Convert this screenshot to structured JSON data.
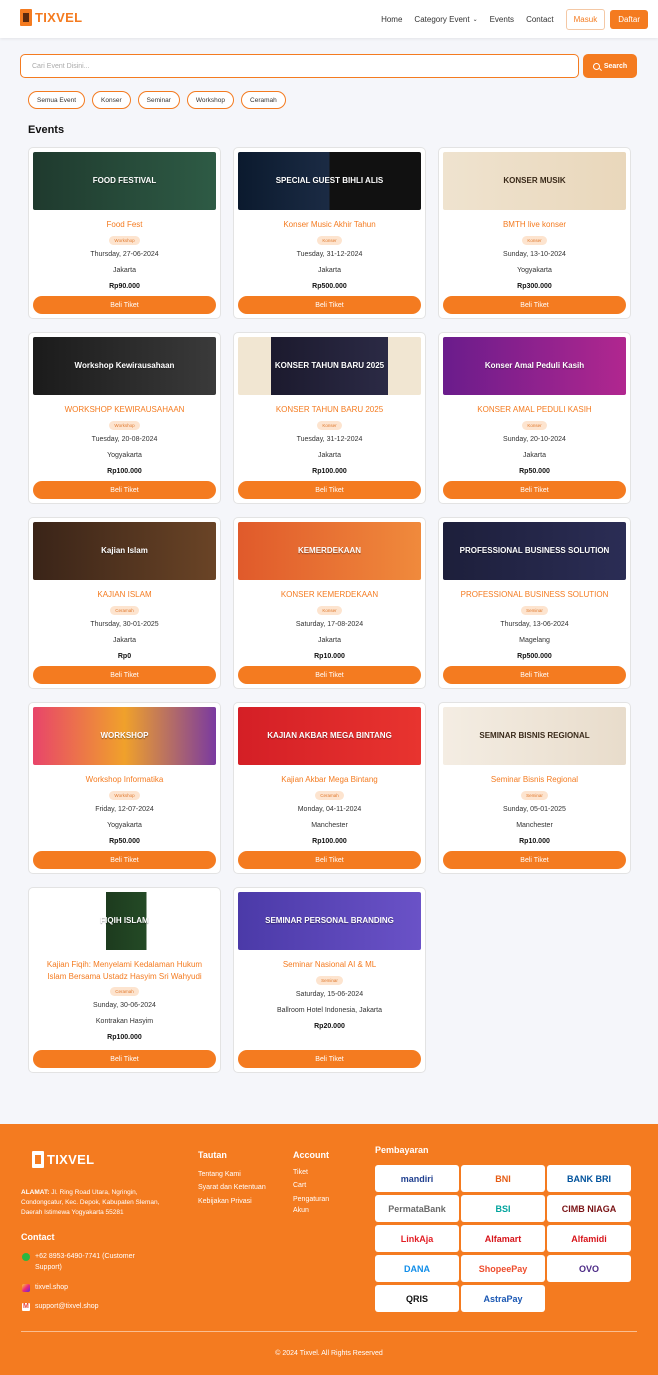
{
  "brand": {
    "name": "TIXVEL"
  },
  "nav": {
    "items": [
      "Home",
      "Category Event",
      "Events",
      "Contact"
    ],
    "login": "Masuk",
    "register": "Daftar"
  },
  "search": {
    "placeholder": "Cari Event Disini...",
    "button": "Search"
  },
  "filters": [
    "Semua Event",
    "Konser",
    "Seminar",
    "Workshop",
    "Ceramah"
  ],
  "section_title": "Events",
  "buy_label": "Beli Tiket",
  "events": [
    {
      "title": "Food Fest",
      "category": "Workshop",
      "date": "Thursday, 27-06-2024",
      "location": "Jakarta",
      "price": "Rp90.000",
      "banner": "FOOD FESTIVAL",
      "bg": "linear-gradient(90deg,#1f3a2e,#2e5b45)"
    },
    {
      "title": "Konser Music Akhir Tahun",
      "category": "Konser",
      "date": "Tuesday, 31-12-2024",
      "location": "Jakarta",
      "price": "Rp500.000",
      "banner": "SPECIAL GUEST BIHLI ALIS",
      "bg": "linear-gradient(90deg,#0b1a2e,#1b2b44 50%,#111 50%)"
    },
    {
      "title": "BMTH live konser",
      "category": "Konser",
      "date": "Sunday, 13-10-2024",
      "location": "Yogyakarta",
      "price": "Rp300.000",
      "banner": "KONSER MUSIK",
      "bg": "linear-gradient(90deg,#efe3cf,#e9d7bb)",
      "dark": true
    },
    {
      "title": "WORKSHOP KEWIRAUSAHAAN",
      "category": "Workshop",
      "date": "Tuesday, 20-08-2024",
      "location": "Yogyakarta",
      "price": "Rp100.000",
      "banner": "Workshop Kewirausahaan",
      "bg": "linear-gradient(90deg,#1b1b1b,#3a3a3a)"
    },
    {
      "title": "KONSER TAHUN BARU 2025",
      "category": "Konser",
      "date": "Tuesday, 31-12-2024",
      "location": "Jakarta",
      "price": "Rp100.000",
      "banner": "KONSER TAHUN BARU 2025",
      "bg": "linear-gradient(90deg,#f1e6d2 18%,#1c1a2e 18%,#2b2a45 82%,#f1e6d2 82%)"
    },
    {
      "title": "KONSER AMAL PEDULI KASIH",
      "category": "Konser",
      "date": "Sunday, 20-10-2024",
      "location": "Jakarta",
      "price": "Rp50.000",
      "banner": "Konser Amal Peduli Kasih",
      "bg": "linear-gradient(90deg,#6a1c8c,#b1278f)"
    },
    {
      "title": "KAJIAN ISLAM",
      "category": "Ceramah",
      "date": "Thursday, 30-01-2025",
      "location": "Jakarta",
      "price": "Rp0",
      "banner": "Kajian Islam",
      "bg": "linear-gradient(90deg,#3a2418,#6a4426)"
    },
    {
      "title": "KONSER KEMERDEKAAN",
      "category": "Konser",
      "date": "Saturday, 17-08-2024",
      "location": "Jakarta",
      "price": "Rp10.000",
      "banner": "KEMERDEKAAN",
      "bg": "linear-gradient(90deg,#e05a2b,#f08a3c)"
    },
    {
      "title": "PROFESSIONAL BUSINESS SOLUTION",
      "category": "Seminar",
      "date": "Thursday, 13-06-2024",
      "location": "Magelang",
      "price": "Rp500.000",
      "banner": "PROFESSIONAL BUSINESS SOLUTION",
      "bg": "linear-gradient(90deg,#1d1f3b,#2b2d55)"
    },
    {
      "title": "Workshop Informatika",
      "category": "Workshop",
      "date": "Friday, 12-07-2024",
      "location": "Yogyakarta",
      "price": "Rp50.000",
      "banner": "WORKSHOP",
      "bg": "linear-gradient(90deg,#e8456a,#f0a12b 50%,#7a3aa0)"
    },
    {
      "title": "Kajian Akbar Mega Bintang",
      "category": "Ceramah",
      "date": "Monday, 04-11-2024",
      "location": "Manchester",
      "price": "Rp100.000",
      "banner": "KAJIAN AKBAR MEGA BINTANG",
      "bg": "linear-gradient(90deg,#d41f26,#e8342f)"
    },
    {
      "title": "Seminar Bisnis Regional",
      "category": "Seminar",
      "date": "Sunday, 05-01-2025",
      "location": "Manchester",
      "price": "Rp10.000",
      "banner": "SEMINAR BISNIS REGIONAL",
      "bg": "linear-gradient(90deg,#f4ede3,#e8dccb)",
      "dark": true
    },
    {
      "title": "Kajian Fiqih: Menyelami Kedalaman Hukum Islam Bersama Ustadz Hasyim Sri Wahyudi",
      "category": "Ceramah",
      "date": "Sunday, 30-06-2024",
      "location": "Kontrakan Hasyim",
      "price": "Rp100.000",
      "banner": "FIQIH ISLAM",
      "bg": "linear-gradient(90deg,#fff 40%,#1d3b1e 40%,#244a26 62%,#fff 62%)",
      "tall": true
    },
    {
      "title": "Seminar Nasional AI & ML",
      "category": "Seminar",
      "date": "Saturday, 15-06-2024",
      "location": "Ballroom Hotel Indonesia, Jakarta",
      "price": "Rp20.000",
      "banner": "SEMINAR PERSONAL BRANDING",
      "bg": "linear-gradient(90deg,#4b3aa8,#6a52c7)",
      "tall": true
    }
  ],
  "footer": {
    "address_label": "ALAMAT:",
    "address": "Jl. Ring Road Utara, Ngringin, Condongcatur, Kec. Depok, Kabupaten Sleman, Daerah Istimewa Yogyakarta 55281",
    "contact_title": "Contact",
    "phone": "+62 8953-6490-7741 (Customer Support)",
    "instagram": "tixvel.shop",
    "email": "support@tixvel.shop",
    "tautan_title": "Tautan",
    "tautan": [
      "Tentang Kami",
      "Syarat dan Ketentuan",
      "Kebijakan Privasi"
    ],
    "account_title": "Account",
    "account": [
      "Tiket",
      "Cart",
      "Pengaturan Akun"
    ],
    "payment_title": "Pembayaran",
    "payments": [
      {
        "name": "mandiri",
        "color": "#1f3f8f"
      },
      {
        "name": "BNI",
        "color": "#e55b13"
      },
      {
        "name": "BANK BRI",
        "color": "#00529c"
      },
      {
        "name": "PermataBank",
        "color": "#6a6a6a"
      },
      {
        "name": "BSI",
        "color": "#00a39d"
      },
      {
        "name": "CIMB NIAGA",
        "color": "#7a1315"
      },
      {
        "name": "LinkAja",
        "color": "#e31e25"
      },
      {
        "name": "Alfamart",
        "color": "#d7141a"
      },
      {
        "name": "Alfamidi",
        "color": "#d7141a"
      },
      {
        "name": "DANA",
        "color": "#118ee9"
      },
      {
        "name": "ShopeePay",
        "color": "#ee4d2d"
      },
      {
        "name": "OVO",
        "color": "#4c2a86"
      },
      {
        "name": "QRIS",
        "color": "#111111"
      },
      {
        "name": "AstraPay",
        "color": "#1a57b3"
      }
    ],
    "copyright": "© 2024 Tixvel. All Rights Reserved"
  }
}
